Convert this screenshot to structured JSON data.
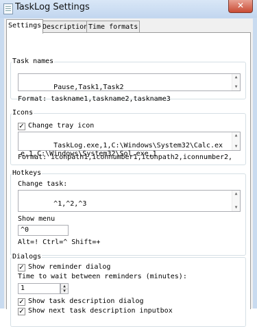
{
  "window": {
    "title": "TaskLog Settings",
    "close_glyph": "✕",
    "app_icon": "notepad-icon"
  },
  "tabs": [
    {
      "label": "Settings",
      "active": true
    },
    {
      "label": "Descriptions",
      "active": false
    },
    {
      "label": "Time formats",
      "active": false
    }
  ],
  "task_names": {
    "title": "Task names",
    "value": "Pause,Task1,Task2",
    "format": "Format: taskname1,taskname2,taskname3"
  },
  "icons": {
    "title": "Icons",
    "change_tray_label": "Change tray icon",
    "change_tray_checked": true,
    "value": "TaskLog.exe,1,C:\\Windows\\System32\\Calc.exe,1,C:\\Windows\\System32\\Sol.exe,1",
    "format": "Format: iconpath1,iconnumber1,iconpath2,iconnumber2,"
  },
  "hotkeys": {
    "title": "Hotkeys",
    "change_task_label": "Change task:",
    "change_task_value": "^1,^2,^3",
    "show_menu_label": "Show menu",
    "show_menu_value": "^0",
    "legend": "Alt=! Ctrl=^ Shift=+"
  },
  "dialogs": {
    "title": "Dialogs",
    "show_reminder_label": "Show reminder dialog",
    "show_reminder_checked": true,
    "wait_label": "Time to wait between reminders (minutes):",
    "wait_value": "1",
    "show_task_desc_label": "Show task description dialog",
    "show_task_desc_checked": true,
    "show_next_label": "Show next task description inputbox",
    "show_next_checked": true
  },
  "check_glyph": "✓"
}
